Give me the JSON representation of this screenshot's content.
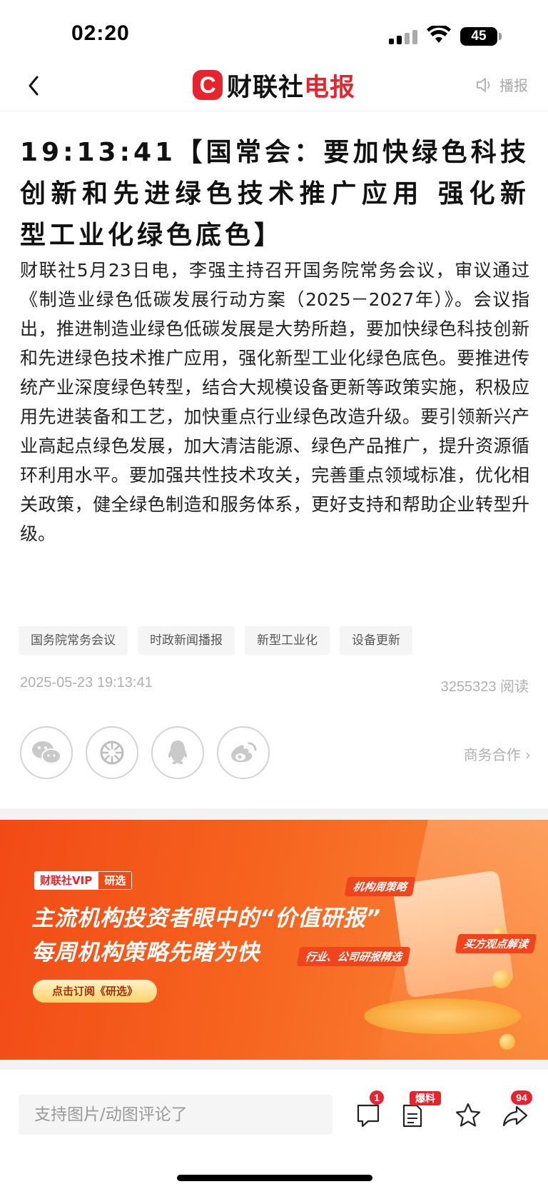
{
  "status_bar": {
    "time": "02:20",
    "battery": "45"
  },
  "header": {
    "logo_mark": "C",
    "logo_black": "财联社",
    "logo_red": "电报",
    "broadcast_label": "播报"
  },
  "article": {
    "headline": "19:13:41【国常会：要加快绿色科技创新和先进绿色技术推广应用 强化新型工业化绿色底色】",
    "body": "财联社5月23日电，李强主持召开国务院常务会议，审议通过《制造业绿色低碳发展行动方案（2025－2027年）》。会议指出，推进制造业绿色低碳发展是大势所趋，要加快绿色科技创新和先进绿色技术推广应用，强化新型工业化绿色底色。要推进传统产业深度绿色转型，结合大规模设备更新等政策实施，积极应用先进装备和工艺，加快重点行业绿色改造升级。要引领新兴产业高起点绿色发展，加大清洁能源、绿色产品推广，提升资源循环利用水平。要加强共性技术攻关，完善重点领域标准，优化相关政策，健全绿色制造和服务体系，更好支持和帮助企业转型升级。",
    "tags": [
      "国务院常务会议",
      "时政新闻播报",
      "新型工业化",
      "设备更新"
    ],
    "datetime": "2025-05-23 19:13:41",
    "reads": "3255323 阅读"
  },
  "share": {
    "icons": [
      "wechat-icon",
      "moments-icon",
      "qq-icon",
      "weibo-icon"
    ],
    "business_link": "商务合作 ›"
  },
  "banner": {
    "badge_left": "财联社VIP",
    "badge_right": "研选",
    "line1": "主流机构投资者眼中的“价值研报”",
    "line2": "每周机构策略先睹为快",
    "cta": "点击订阅《研选》",
    "pill1": "机构周策略",
    "pill2": "行业、公司研报精选",
    "pill3": "买方观点解读"
  },
  "bottom_bar": {
    "comment_placeholder": "支持图片/动图评论了",
    "comment_count": "1",
    "tip_label": "爆料",
    "share_count": "94"
  },
  "colors": {
    "brand_red": "#e5252e",
    "banner_orange": "#f24a16",
    "muted_gray": "#b0b0b0"
  }
}
